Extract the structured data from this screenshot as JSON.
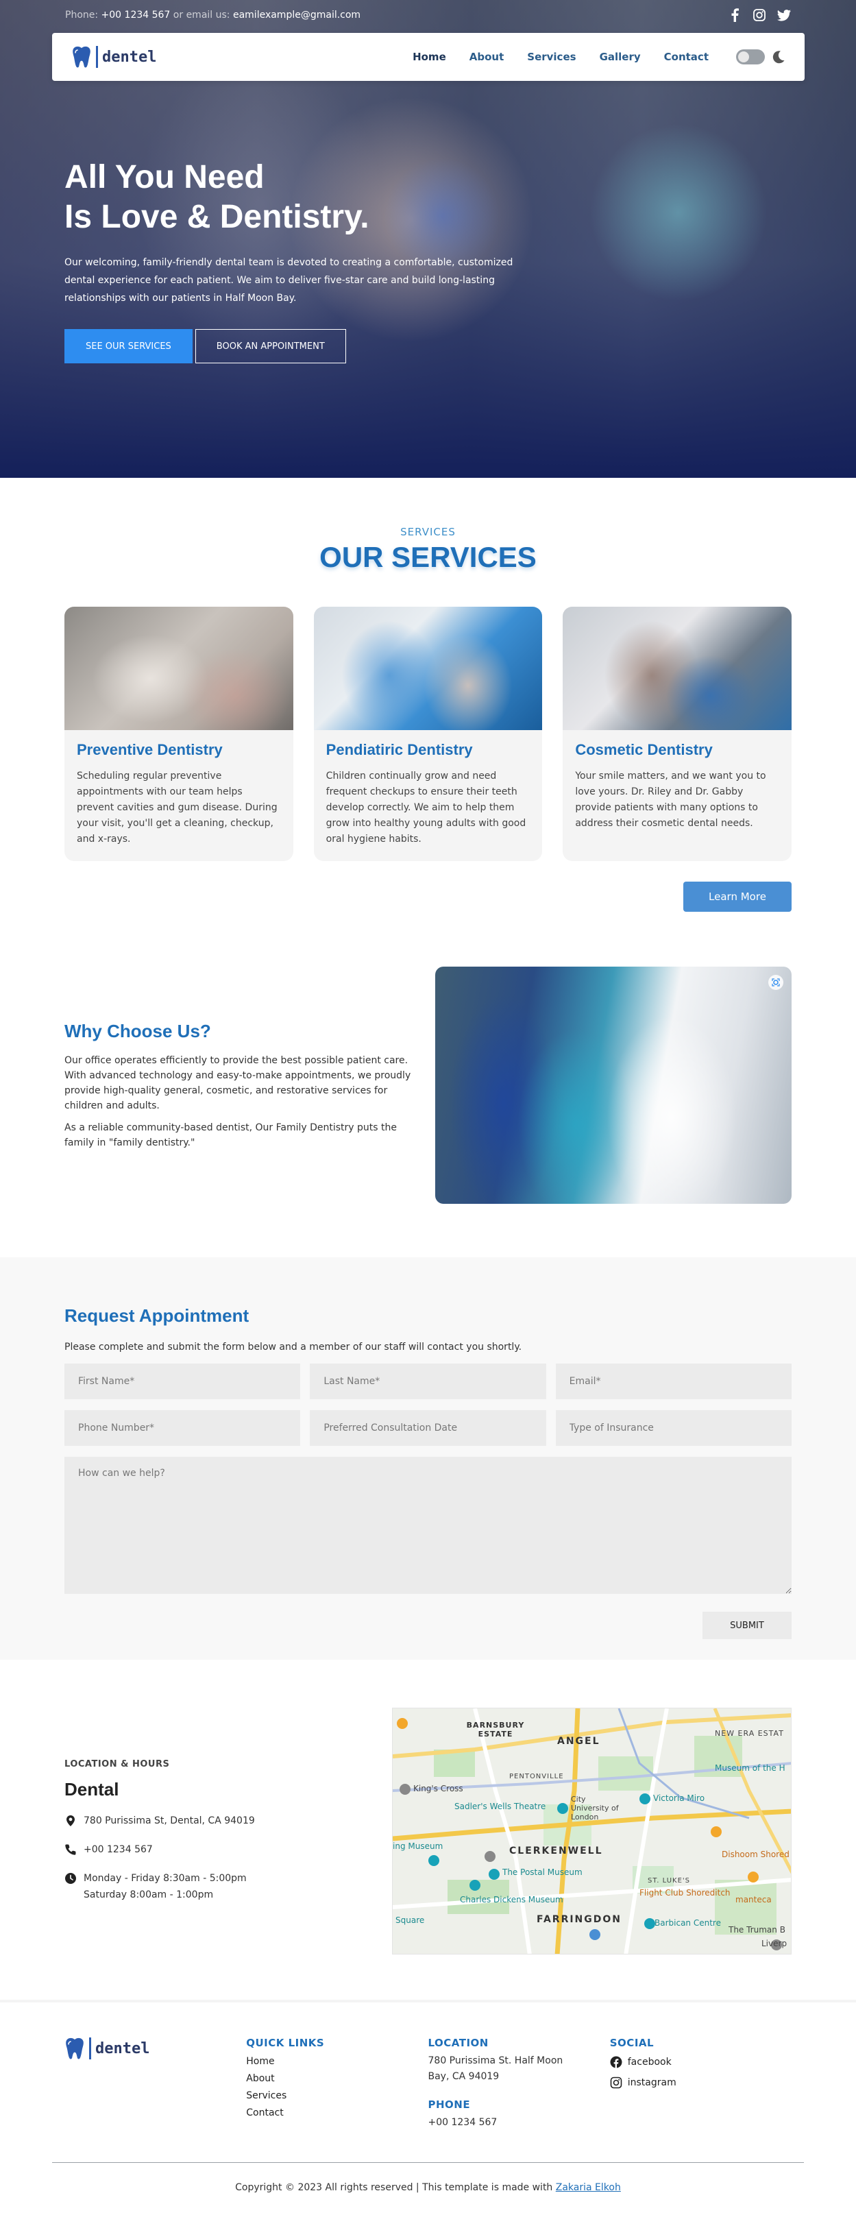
{
  "topbar": {
    "phone_label": "Phone:",
    "phone": "+00 1234 567",
    "or_label": "or email us:",
    "email": "eamilexample@gmail.com",
    "social_icons": [
      "facebook-icon",
      "instagram-icon",
      "twitter-icon"
    ]
  },
  "nav": {
    "logo_text": "dentel",
    "links": [
      "Home",
      "About",
      "Services",
      "Gallery",
      "Contact"
    ],
    "active": "Home"
  },
  "hero": {
    "title_line1": "All You Need",
    "title_line2": "Is Love & Dentistry.",
    "description": "Our welcoming, family-friendly dental team is devoted to creating a comfortable, customized dental experience for each patient. We aim to deliver five-star care and build long-lasting relationships with our patients in Half Moon Bay.",
    "primary_button": "SEE OUR SERVICES",
    "secondary_button": "BOOK AN APPOINTMENT"
  },
  "services": {
    "eyebrow": "SERVICES",
    "title": "OUR SERVICES",
    "cards": [
      {
        "title": "Preventive Dentistry",
        "text": "Scheduling regular preventive appointments with our team helps prevent cavities and gum disease. During your visit, you'll get a cleaning, checkup, and x-rays."
      },
      {
        "title": "Pendiatiric Dentistry",
        "text": "Children continually grow and need frequent checkups to ensure their teeth develop correctly. We aim to help them grow into healthy young adults with good oral hygiene habits."
      },
      {
        "title": "Cosmetic Dentistry",
        "text": "Your smile matters, and we want you to love yours. Dr. Riley and Dr. Gabby provide patients with many options to address their cosmetic dental needs."
      }
    ],
    "learn_more": "Learn More"
  },
  "why": {
    "title": "Why Choose Us?",
    "paragraph1": "Our office operates efficiently to provide the best possible patient care. With advanced technology and easy-to-make appointments, we proudly provide high-quality general, cosmetic, and restorative services for children and adults.",
    "paragraph2": "As a reliable community-based dentist, Our Family Dentistry puts the family in \"family dentistry.\""
  },
  "appointment": {
    "title": "Request Appointment",
    "intro": "Please complete and submit the form below and a member of our staff will contact you shortly.",
    "placeholders": {
      "first_name": "First Name*",
      "last_name": "Last Name*",
      "email": "Email*",
      "phone": "Phone Number*",
      "date": "Preferred Consultation Date",
      "insurance": "Type of Insurance",
      "message": "How can we help?"
    },
    "submit": "SUBMIT"
  },
  "location": {
    "eyebrow": "LOCATION & HOURS",
    "title": "Dental",
    "address": "780 Purissima St, Dental, CA 94019",
    "phone": "+00 1234 567",
    "hours_line1": "Monday - Friday 8:30am - 5:00pm",
    "hours_line2": "Saturday 8:00am - 1:00pm",
    "map_labels": {
      "barnsbury": "BARNSBURY ESTATE",
      "angel": "ANGEL",
      "new_era": "NEW ERA ESTAT",
      "kings_cross": "King's Cross",
      "pentonville": "PENTONVILLE",
      "sadlers": "Sadler's Wells Theatre",
      "city_uni": "City University of London",
      "victoria_miro": "Victoria Miro",
      "museum_home": "Museum of the H",
      "museum": "ing Museum",
      "clerkenwell": "CLERKENWELL",
      "postal_museum": "The Postal Museum",
      "dishoom": "Dishoom Shored",
      "st_lukes": "ST. LUKE'S",
      "flight_club": "Flight Club Shoreditch",
      "manteca": "manteca",
      "dickens": "Charles Dickens Museum",
      "farringdon": "FARRINGDON",
      "barbican": "Barbican Centre",
      "truman": "The Truman B",
      "square": "Square",
      "liverpool": "Liverp"
    }
  },
  "footer": {
    "logo_text": "dentel",
    "quick_links_title": "QUICK LINKS",
    "quick_links": [
      "Home",
      "About",
      "Services",
      "Contact"
    ],
    "location_title": "LOCATION",
    "location_text": "780 Purissima St. Half Moon Bay, CA 94019",
    "phone_title": "PHONE",
    "phone": "+00 1234 567",
    "social_title": "SOCIAL",
    "social": [
      "facebook",
      "instagram"
    ],
    "copyright_prefix": "Copyright © 2023 All rights reserved | This template is made with ",
    "copyright_author": "Zakaria Elkoh"
  },
  "colors": {
    "brand_blue": "#1f6fb8",
    "hero_navy": "#14205a",
    "primary_button": "#2e8df0",
    "learn_more_button": "#4a8fd4",
    "soft_gray": "#ebebeb"
  }
}
